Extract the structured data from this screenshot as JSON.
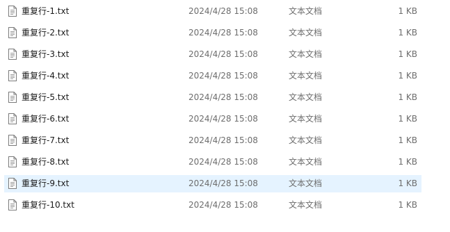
{
  "files": [
    {
      "name": "重复行-1.txt",
      "modified": "2024/4/28 15:08",
      "type": "文本文档",
      "size": "1 KB"
    },
    {
      "name": "重复行-2.txt",
      "modified": "2024/4/28 15:08",
      "type": "文本文档",
      "size": "1 KB"
    },
    {
      "name": "重复行-3.txt",
      "modified": "2024/4/28 15:08",
      "type": "文本文档",
      "size": "1 KB"
    },
    {
      "name": "重复行-4.txt",
      "modified": "2024/4/28 15:08",
      "type": "文本文档",
      "size": "1 KB"
    },
    {
      "name": "重复行-5.txt",
      "modified": "2024/4/28 15:08",
      "type": "文本文档",
      "size": "1 KB"
    },
    {
      "name": "重复行-6.txt",
      "modified": "2024/4/28 15:08",
      "type": "文本文档",
      "size": "1 KB"
    },
    {
      "name": "重复行-7.txt",
      "modified": "2024/4/28 15:08",
      "type": "文本文档",
      "size": "1 KB"
    },
    {
      "name": "重复行-8.txt",
      "modified": "2024/4/28 15:08",
      "type": "文本文档",
      "size": "1 KB"
    },
    {
      "name": "重复行-9.txt",
      "modified": "2024/4/28 15:08",
      "type": "文本文档",
      "size": "1 KB",
      "selected": true
    },
    {
      "name": "重复行-10.txt",
      "modified": "2024/4/28 15:08",
      "type": "文本文档",
      "size": "1 KB"
    }
  ],
  "icons": {
    "file": "text-file-icon"
  },
  "colors": {
    "selected_row": "#e5f3ff",
    "secondary_text": "#6d6d6d"
  }
}
